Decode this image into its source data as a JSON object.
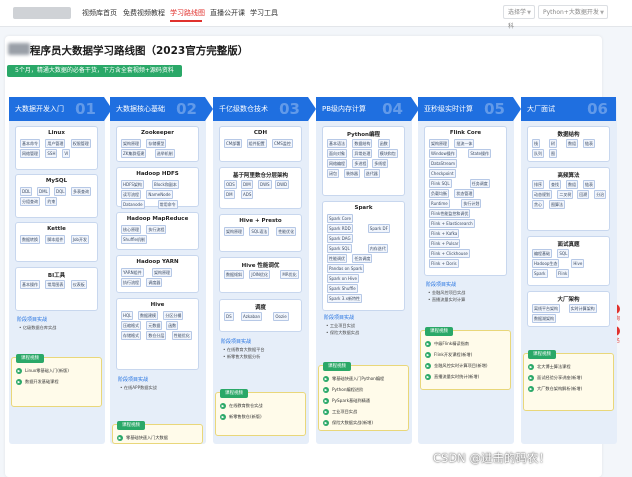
{
  "topbar": {
    "nav": [
      "视频库首页",
      "免费视频教程",
      "学习路线图",
      "直播公开课",
      "学习工具"
    ],
    "active_nav": "学习路线图",
    "select1_placeholder": "选择学科",
    "select2_value": "Python+大数据开发"
  },
  "sidebar": {
    "consult": "咨询",
    "apply": "报名"
  },
  "page": {
    "title": "程序员大数据学习路线图（2023官方完整版）",
    "subtitle": "5个月，精通大数据的必备干货，下方含全套视频+源码资料"
  },
  "columns": [
    {
      "header": "大数据开发入门",
      "num": "01",
      "boxes": [
        {
          "title": "Linux",
          "tags": [
            "基本命令",
            "用户管理",
            "权限管理",
            "网络管理",
            "SSH",
            "VI"
          ]
        },
        {
          "title": "MySQL",
          "tags": [
            "DDL",
            "DML",
            "DQL",
            "多表查询",
            "分组查询",
            "约束"
          ]
        },
        {
          "title": "Kettle",
          "tags": [
            "数据转换",
            "脚本组件",
            "Job开发"
          ]
        },
        {
          "title": "BI工具",
          "tags": [
            "基本操作",
            "常用图表",
            "仪表板"
          ]
        }
      ],
      "project_label": "阶段项目实战",
      "projects": [
        "亿级数据仓库实战"
      ],
      "course_chip": "课程视频",
      "courses": [
        "Linux零基础入门(新版)",
        "数据开发基础课程"
      ]
    },
    {
      "header": "大数据核心基础",
      "num": "02",
      "boxes": [
        {
          "title": "Zookeeper",
          "tags": [
            "架构原理",
            "存储模型",
            "ZK集群搭建",
            "选举机制"
          ]
        },
        {
          "title": "Hadoop HDFS",
          "tags": [
            "HDFS架构",
            "Block和副本",
            "读写流程",
            "NameNode",
            "Datanode",
            "常用命令"
          ]
        },
        {
          "title": "Hadoop MapReduce",
          "tags": [
            "核心原理",
            "执行流程",
            "Shuffle机制"
          ]
        },
        {
          "title": "Hadoop YARN",
          "tags": [
            "YARN组件",
            "架构原理",
            "执行流程",
            "调度器"
          ]
        },
        {
          "title": "Hive",
          "tags": [
            "HQL",
            "数据建模",
            "分区分桶",
            "压缩格式",
            "元数据",
            "函数",
            "存储格式",
            "数仓分层",
            "性能优化"
          ]
        }
      ],
      "project_label": "阶段项目实战",
      "projects": [
        "在线APP数据实战"
      ],
      "course_chip": "课程视频",
      "courses": [
        "零基础快速入门大数据"
      ]
    },
    {
      "header": "千亿级数仓技术",
      "num": "03",
      "boxes": [
        {
          "title": "CDH",
          "tags": [
            "CM部署",
            "组件配置",
            "CMS监控"
          ]
        },
        {
          "title": "基于阿里数仓分层架构",
          "tags": [
            "ODS",
            "DIM",
            "DWS",
            "DWD",
            "DM",
            "ADS"
          ]
        },
        {
          "title": "Hive + Presto",
          "tags": [
            "架构原理",
            "SQL语法",
            "性能优化"
          ]
        },
        {
          "title": "Hive 性能调优",
          "tags": [
            "数据倾斜",
            "JOIN优化",
            "MR优化"
          ]
        },
        {
          "title": "调度",
          "tags": [
            "DS",
            "Azkaban",
            "Oozie"
          ]
        }
      ],
      "project_label": "阶段项目实战",
      "projects": [
        "在线教育大数据平台",
        "新零售大数据分析"
      ],
      "course_chip": "课程视频",
      "courses": [
        "在线教育数仓实战",
        "新零售数仓(新版)"
      ]
    },
    {
      "header": "PB级内存计算",
      "num": "04",
      "boxes": [
        {
          "title": "Python编程",
          "tags": [
            "基本语法",
            "数据结构",
            "函数",
            "面向对象",
            "异常处理",
            "模块和包",
            "网络编程",
            "多进程",
            "多线程",
            "闭包",
            "装饰器",
            "迭代器"
          ]
        },
        {
          "title": "Spark",
          "tags": [
            "Spark Core",
            "Spark RDD",
            "Spark DF",
            "Spark DAG",
            "Spark SQL",
            "内存迭代",
            "性能调优",
            "任务调度",
            "Pandas on Spark",
            "Spark on Hive",
            "Spark Shuffle",
            "Spark 3.x新特性"
          ]
        }
      ],
      "project_label": "阶段项目实战",
      "projects": [
        "工业项目实战",
        "保险大数据实战"
      ],
      "course_chip": "课程视频",
      "courses": [
        "零基础快速入门Python编程",
        "Python编程进阶",
        "PySpark基础到精通",
        "工业项目实战",
        "保险大数据实战(新增)"
      ]
    },
    {
      "header": "亚秒级实时计算",
      "num": "05",
      "boxes": [
        {
          "title": "Flink Core",
          "tags": [
            "架构原理",
            "批流一体",
            "Window操作",
            "State操作",
            "DataStream",
            "Checkpoint",
            "Flink SQL",
            "任务调度",
            "负载均衡",
            "状态管理",
            "Runtime",
            "执行计划",
            "Flink性能监控和调优",
            "Flink + Elasticsearch",
            "Flink + Kafka",
            "Flink + Pulsar",
            "Flink + Clickhouse",
            "Flink + Doris"
          ]
        }
      ],
      "project_label": "阶段项目实战",
      "projects": [
        "金融风控项目实战",
        "直播流量实时计算"
      ],
      "course_chip": "课程视频",
      "courses": [
        "中级Flink精读指南",
        "Flink开发课程(新增)",
        "金融风控实时计算项目(新增)",
        "直播流量实时统计(新增)"
      ]
    },
    {
      "header": "大厂面试",
      "num": "06",
      "boxes": [
        {
          "title": "数据结构",
          "tags": [
            "栈",
            "树",
            "数组",
            "链表",
            "队列",
            "图"
          ]
        },
        {
          "title": "高频算法",
          "tags": [
            "排序",
            "查找",
            "数组",
            "链表",
            "动态规划",
            "二叉树",
            "回溯",
            "分治",
            "贪心",
            "图算法"
          ]
        },
        {
          "title": "面试真题",
          "tags": [
            "编程基础",
            "SQL",
            "Hadoop生态",
            "Hive",
            "Spark",
            "Flink"
          ]
        },
        {
          "title": "大厂架构",
          "tags": [
            "离线平台架构",
            "实时计算架构",
            "数据湖架构"
          ]
        }
      ],
      "project_label": "",
      "projects": [],
      "course_chip": "课程视频",
      "courses": [
        "北大博士算法课程",
        "面试经验分享讲座(新增)",
        "大厂数仓架构解析(新增)"
      ]
    }
  ],
  "watermark": "CSDN @进击的码农！"
}
